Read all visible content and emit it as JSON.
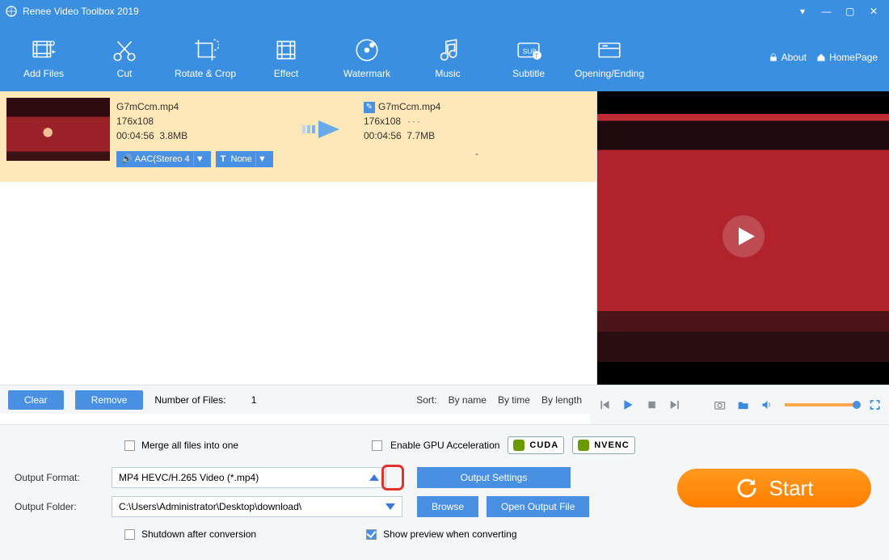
{
  "title": "Renee Video Toolbox 2019",
  "toolbar": {
    "items": [
      "Add Files",
      "Cut",
      "Rotate & Crop",
      "Effect",
      "Watermark",
      "Music",
      "Subtitle",
      "Opening/Ending"
    ],
    "about": "About",
    "homepage": "HomePage"
  },
  "file": {
    "src": {
      "name": "G7mCcm.mp4",
      "dim": "176x108",
      "dur": "00:04:56",
      "size": "3.8MB",
      "audio": "AAC(Stereo 4",
      "text": "None"
    },
    "dst": {
      "name": "G7mCcm.mp4",
      "dim": "176x108",
      "dur": "00:04:56",
      "size": "7.7MB"
    },
    "audio_prefix": "🔊",
    "text_prefix": "T",
    "dash": "-"
  },
  "strip": {
    "clear": "Clear",
    "remove": "Remove",
    "count_label": "Number of Files:",
    "count": "1",
    "sort_label": "Sort:",
    "byname": "By name",
    "bytime": "By time",
    "bylength": "By length"
  },
  "settings": {
    "merge": "Merge all files into one",
    "gpu": "Enable GPU Acceleration",
    "cuda": "CUDA",
    "nvenc": "NVENC",
    "format_label": "Output Format:",
    "format_value": "MP4 HEVC/H.265 Video (*.mp4)",
    "output_settings": "Output Settings",
    "folder_label": "Output Folder:",
    "folder_value": "C:\\Users\\Administrator\\Desktop\\download\\",
    "browse": "Browse",
    "open_folder": "Open Output File",
    "shutdown": "Shutdown after conversion",
    "show_preview": "Show preview when converting",
    "start": "Start"
  }
}
